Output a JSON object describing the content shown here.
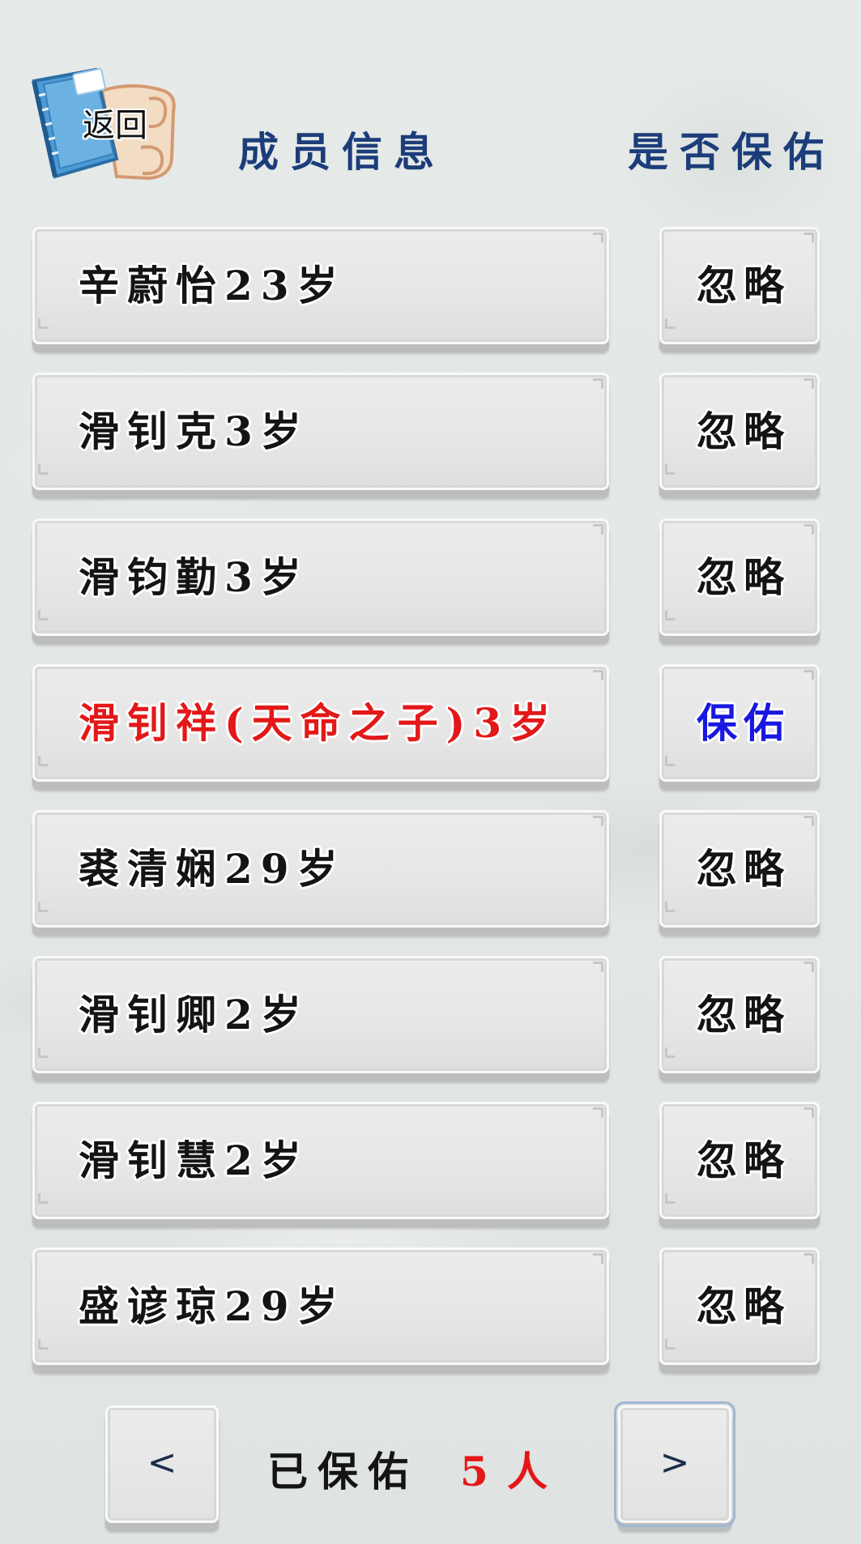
{
  "back": {
    "label": "返回"
  },
  "headers": {
    "member_info": "成员信息",
    "bless": "是否保佑"
  },
  "members": [
    {
      "label": "辛蔚怡23岁",
      "action": "忽略",
      "highlight": false
    },
    {
      "label": "滑钊克3岁",
      "action": "忽略",
      "highlight": false
    },
    {
      "label": "滑钧勤3岁",
      "action": "忽略",
      "highlight": false
    },
    {
      "label": "滑钊祥(天命之子)3岁",
      "action": "保佑",
      "highlight": true
    },
    {
      "label": "裘清娴29岁",
      "action": "忽略",
      "highlight": false
    },
    {
      "label": "滑钊卿2岁",
      "action": "忽略",
      "highlight": false
    },
    {
      "label": "滑钊慧2岁",
      "action": "忽略",
      "highlight": false
    },
    {
      "label": "盛谚琼29岁",
      "action": "忽略",
      "highlight": false
    }
  ],
  "pager": {
    "prev": "<",
    "next": ">"
  },
  "status": {
    "label": "已保佑",
    "count": "5",
    "unit": "人"
  },
  "colors": {
    "header": "#1c3d7a",
    "highlight": "#e31818",
    "active_action": "#1818e0"
  },
  "icons": {
    "back": "book-scroll-icon"
  }
}
